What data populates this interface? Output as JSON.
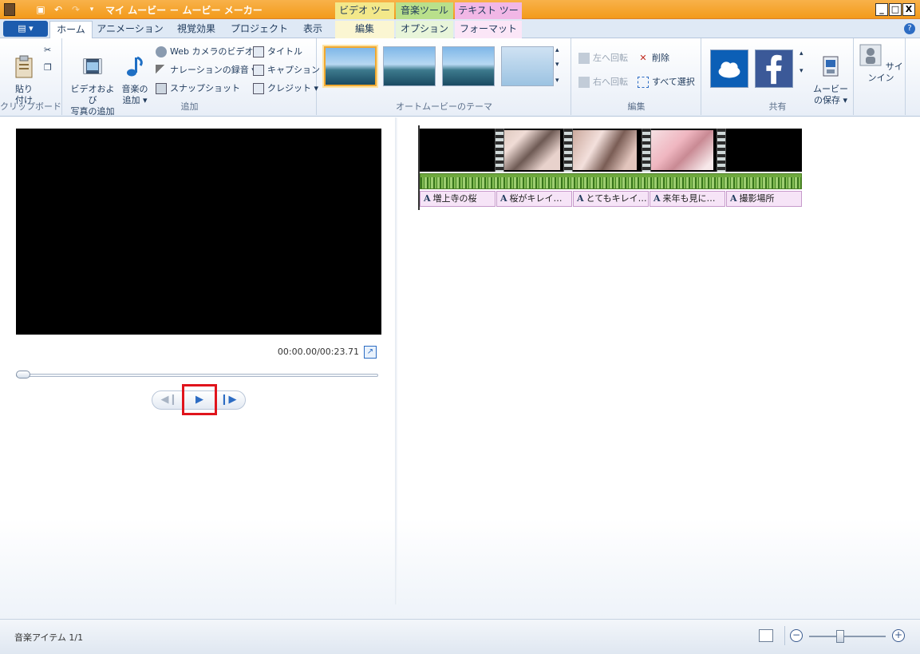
{
  "window": {
    "title": "マイ ムービー － ムービー メーカー",
    "context_tabs": {
      "video_tools": "ビデオ ツール",
      "music_tools": "音楽ツール",
      "text_tools": "テキスト ツール"
    },
    "controls": {
      "minimize": "_",
      "maximize": "□",
      "close": "X"
    }
  },
  "tabs": {
    "file_menu": "▤ ▾",
    "items": [
      "ホーム",
      "アニメーション",
      "視覚効果",
      "プロジェクト",
      "表示",
      "編集",
      "オプション",
      "フォーマット"
    ],
    "help": "?"
  },
  "ribbon": {
    "clipboard": {
      "label": "クリップボード",
      "paste": "貼り\n付け"
    },
    "add": {
      "label": "追加",
      "add_videos_photos": "ビデオおよび\n写真の追加",
      "add_music": "音楽の\n追加 ▾",
      "webcam_video": "Web カメラのビデオ",
      "record_narration": "ナレーションの録音 ▾",
      "snapshot": "スナップショット",
      "title": "タイトル",
      "caption": "キャプション",
      "credits": "クレジット ▾"
    },
    "themes": {
      "label": "オートムービーのテーマ"
    },
    "editing": {
      "label": "編集",
      "rotate_left": "左へ回転",
      "rotate_right": "右へ回転",
      "remove": "削除",
      "select_all": "すべて選択"
    },
    "share": {
      "label": "共有",
      "save_movie": "ムービー\nの保存 ▾"
    },
    "sign_in": "サインイン"
  },
  "preview": {
    "timecode": "00:00.00/00:23.71",
    "progress_fraction": 0.0
  },
  "storyboard": {
    "captions": [
      "増上寺の桜",
      "桜がキレイ…",
      "とてもキレイ…",
      "来年も見に…",
      "撮影場所"
    ]
  },
  "status": {
    "text": "音楽アイテム 1/1",
    "zoom_fraction": 0.42
  },
  "colors": {
    "title_bar": "#f39a1b",
    "accent_blue": "#1c5cae",
    "highlight_red": "#e0141c",
    "audio_green": "#6fa93e",
    "caption_pink": "#f6e4f7"
  }
}
